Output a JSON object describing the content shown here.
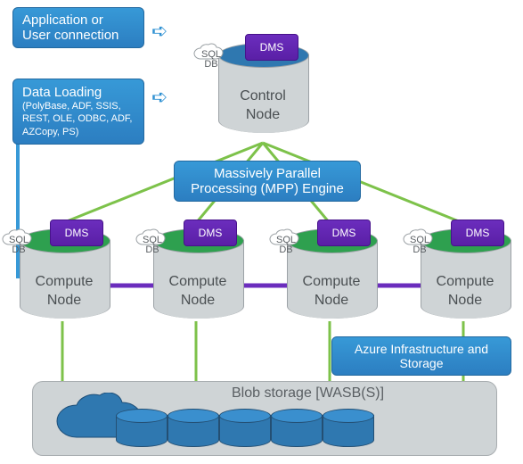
{
  "app_box": {
    "line1": "Application or",
    "line2": "User connection"
  },
  "data_box": {
    "title": "Data Loading",
    "sub": "(PolyBase, ADF, SSIS, REST, OLE, ODBC, ADF, AZCopy, PS)"
  },
  "mpp_box": {
    "line1": "Massively Parallel",
    "line2": "Processing (MPP) Engine"
  },
  "azure_box": {
    "line1": "Azure Infrastructure and",
    "line2": "Storage"
  },
  "dms_label": "DMS",
  "sqldb_label_l1": "SQL",
  "sqldb_label_l2": "DB",
  "control_node_l1": "Control",
  "control_node_l2": "Node",
  "compute_node_l1": "Compute",
  "compute_node_l2": "Node",
  "blob_label": "Blob storage [WASB(S)]",
  "colors": {
    "box_blue": "#3799d7",
    "dms_purple": "#6b2dbd",
    "cylinder": "#cfd4d6",
    "green_line": "#7dc24a",
    "purple_line": "#6b2dbd",
    "top_blue": "#2f78b0",
    "top_green": "#2ea04f"
  }
}
